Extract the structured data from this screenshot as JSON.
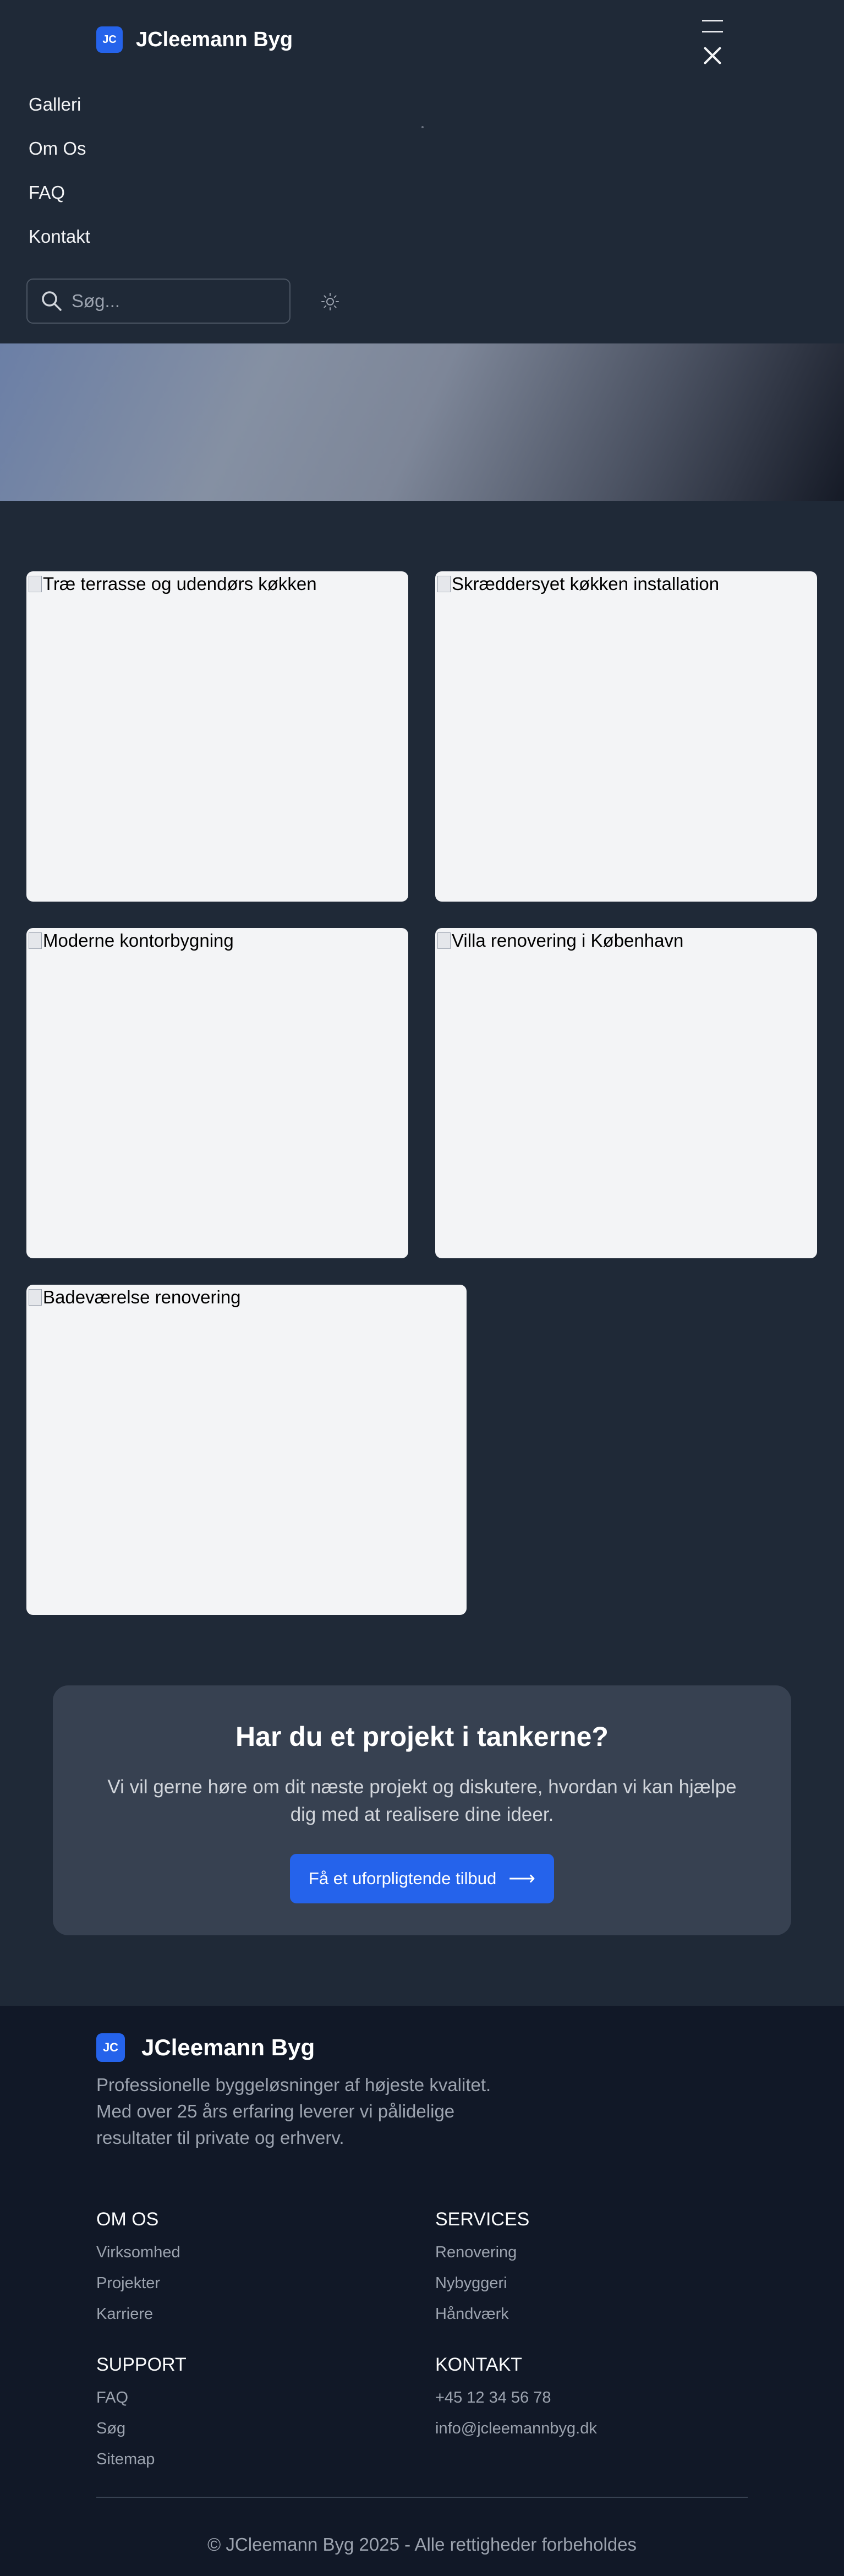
{
  "header": {
    "logo_text": "JC",
    "brand_name": "JCleemann Byg",
    "menu_icon": "hamburger-close-icon"
  },
  "nav": {
    "items": [
      {
        "label": "Galleri"
      },
      {
        "label": "Om Os"
      },
      {
        "label": "FAQ"
      },
      {
        "label": "Kontakt"
      }
    ]
  },
  "search": {
    "placeholder": "Søg...",
    "value": "",
    "icon": "search-icon"
  },
  "theme_toggle": {
    "icon": "sun-icon"
  },
  "gallery": {
    "items": [
      {
        "alt": "Træ terrasse og udendørs køkken"
      },
      {
        "alt": "Skræddersyet køkken installation"
      },
      {
        "alt": "Moderne kontorbygning"
      },
      {
        "alt": "Villa renovering i København"
      },
      {
        "alt": "Badeværelse renovering"
      }
    ]
  },
  "cta": {
    "title": "Har du et projekt i tankerne?",
    "text": "Vi vil gerne høre om dit næste projekt og diskutere, hvordan vi kan hjælpe dig med at realisere dine ideer.",
    "button_label": "Få et uforpligtende tilbud",
    "button_icon": "arrow-right-icon"
  },
  "footer": {
    "logo_text": "JC",
    "brand_name": "JCleemann Byg",
    "description": "Professionelle byggeløsninger af højeste kvalitet. Med over 25 års erfaring leverer vi pålidelige resultater til private og erhverv.",
    "columns": [
      {
        "title": "OM OS",
        "links": [
          "Virksomhed",
          "Projekter",
          "Karriere"
        ]
      },
      {
        "title": "SERVICES",
        "links": [
          "Renovering",
          "Nybyggeri",
          "Håndværk"
        ]
      },
      {
        "title": "SUPPORT",
        "links": [
          "FAQ",
          "Søg",
          "Sitemap"
        ]
      },
      {
        "title": "KONTAKT",
        "links": [
          "+45 12 34 56 78",
          "info@jcleemannbyg.dk"
        ]
      }
    ],
    "copyright": "© JCleemann Byg 2025 - Alle rettigheder forbeholdes"
  },
  "colors": {
    "background": "#1f2937",
    "footer_background": "#111827",
    "accent": "#2563eb",
    "card_background": "#f3f4f6",
    "cta_background": "#374151"
  }
}
